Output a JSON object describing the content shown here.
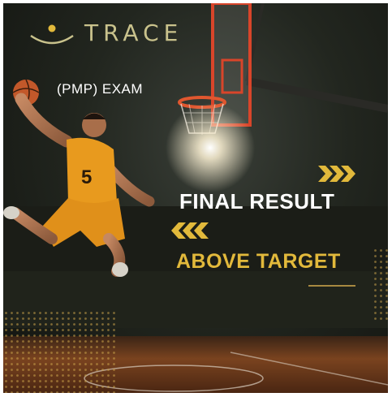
{
  "poster": {
    "brand_name": "TRACE",
    "exam_label": "(PMP) EXAM",
    "result_title": "FINAL RESULT",
    "result_value": "ABOVE TARGET",
    "player_number": "5",
    "icons": {
      "logo": "arc-with-dot-logo",
      "forward_arrows": "triple-chevron-right-icon",
      "back_arrows": "triple-chevron-left-icon"
    },
    "colors": {
      "gold": "#e2b93b",
      "white": "#ffffff",
      "jersey": "#e89a1e",
      "court": "#6a3a1c",
      "background": "#1a1c16"
    }
  }
}
